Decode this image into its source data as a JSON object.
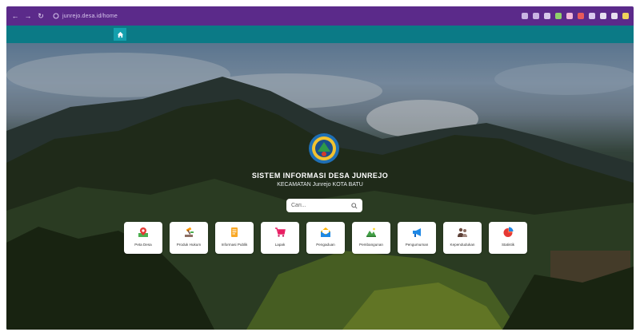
{
  "browser": {
    "url": "junrejo.desa.id/home",
    "accent": "#5b2a8a"
  },
  "nav": {
    "home_icon": "home-icon",
    "bar_color": "#0b7a86"
  },
  "hero": {
    "title": "SISTEM INFORMASI DESA JUNREJO",
    "subtitle": "KECAMATAN Junrejo KOTA BATU",
    "search_placeholder": "Cari..."
  },
  "menu": [
    {
      "label": "Peta Desa",
      "icon": "map-pin-icon"
    },
    {
      "label": "Produk Hukum",
      "icon": "gavel-icon"
    },
    {
      "label": "Informasi Publik",
      "icon": "document-icon"
    },
    {
      "label": "Lapak",
      "icon": "cart-icon"
    },
    {
      "label": "Pengaduan",
      "icon": "mail-icon"
    },
    {
      "label": "Pembangunan",
      "icon": "landscape-icon"
    },
    {
      "label": "Pengumuman",
      "icon": "megaphone-icon"
    },
    {
      "label": "Kependudukan",
      "icon": "people-icon"
    },
    {
      "label": "Statistik",
      "icon": "pie-chart-icon"
    }
  ]
}
